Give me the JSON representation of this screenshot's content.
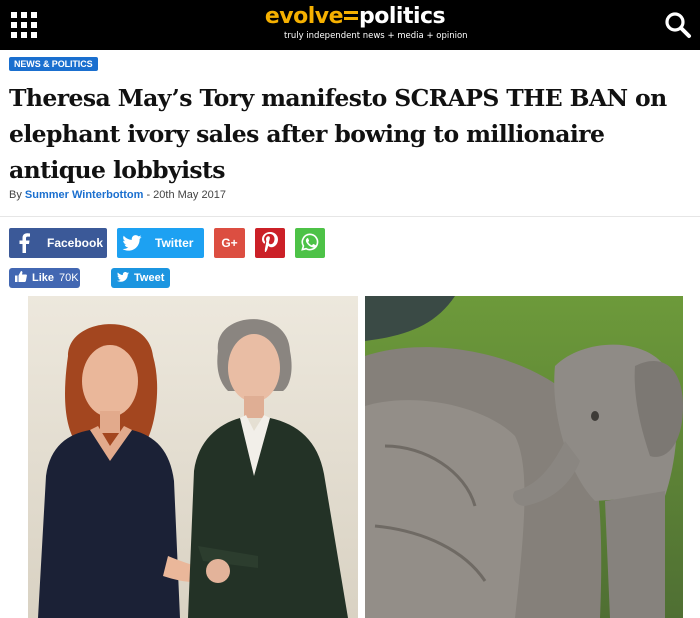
{
  "header": {
    "logo_evolve": "evolve",
    "logo_politics": "politics",
    "logo_tagline": "truly independent news + media + opinion",
    "menu_icon": "grid-menu-icon",
    "search_icon": "search-icon",
    "colors": {
      "bar": "#000000",
      "accent": "#f5b000"
    }
  },
  "article": {
    "category": "NEWS & POLITICS",
    "title": "Theresa May’s Tory manifesto SCRAPS THE BAN on elephant ivory sales after bowing to millionaire antique lobbyists",
    "byline_prefix": "By",
    "author": "Summer Winterbottom",
    "byline_separator": "-",
    "date": "20th May 2017"
  },
  "share": {
    "facebook_label": "Facebook",
    "twitter_label": "Twitter",
    "gplus_label": "G+",
    "like_label": "Like",
    "like_count": "70K",
    "tweet_label": "Tweet",
    "colors": {
      "facebook": "#3b5998",
      "twitter": "#1da1f2",
      "gplus": "#dc4e41",
      "pinterest": "#cb2027",
      "whatsapp": "#4dc247"
    }
  },
  "images": [
    {
      "name": "two-women-handshake-photo"
    },
    {
      "name": "elephants-photo"
    }
  ]
}
